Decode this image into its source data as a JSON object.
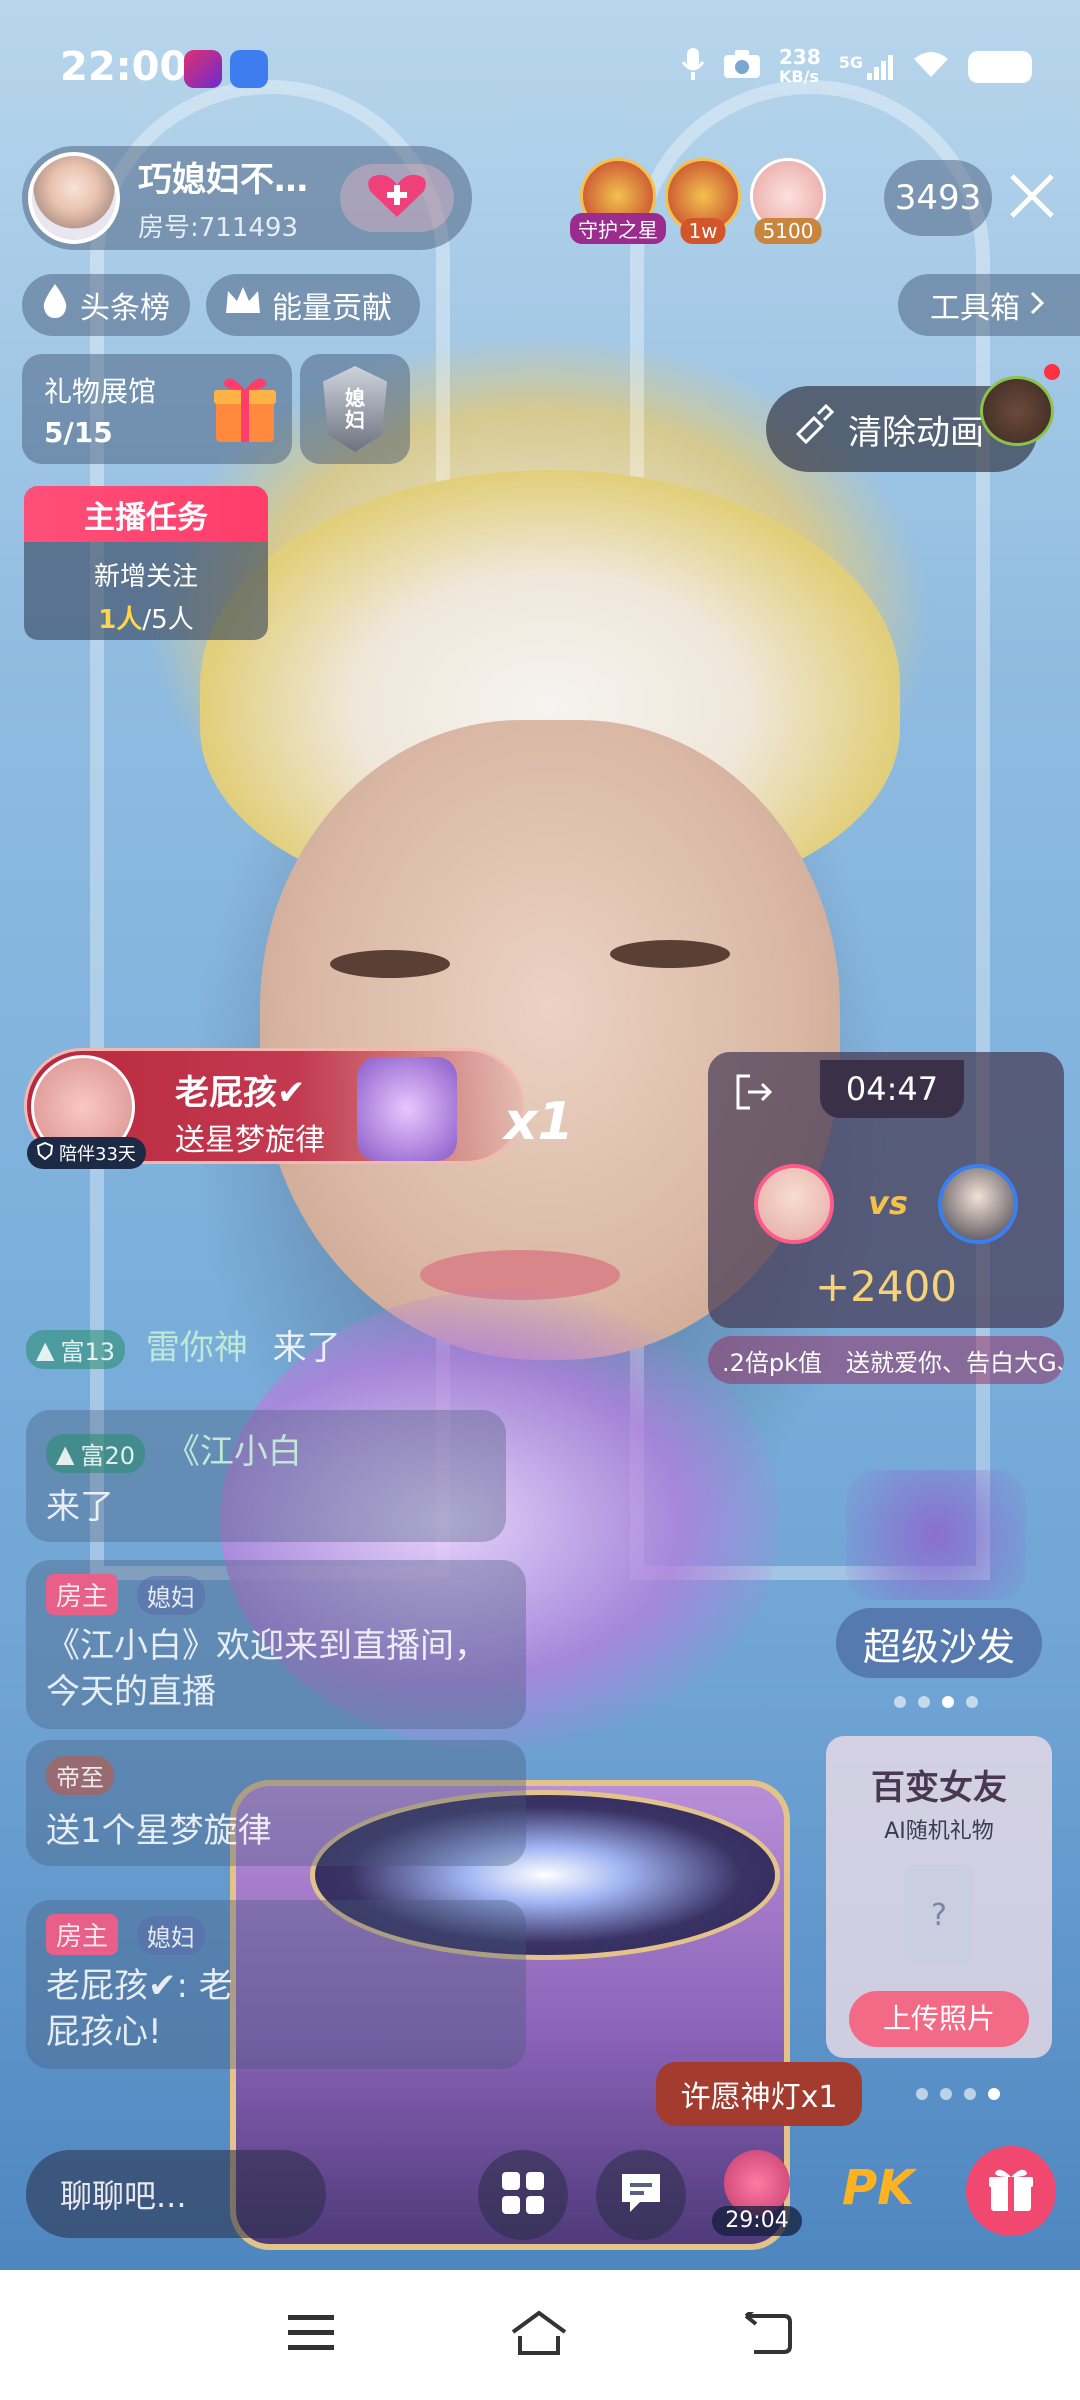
{
  "status_bar": {
    "time": "22:00",
    "network_speed_value": "238",
    "network_speed_unit": "KB/s",
    "signal_label": "5G"
  },
  "host": {
    "name": "巧媳妇不…",
    "room_id": "房号:711493"
  },
  "top_viewers": [
    {
      "tag": "守护之星"
    },
    {
      "tag": "1w"
    },
    {
      "tag": "5100"
    }
  ],
  "viewer_count": "3493",
  "rank_buttons": {
    "headline": "头条榜",
    "energy": "能量贡献",
    "toolbox": "工具箱"
  },
  "gift_hall": {
    "label": "礼物展馆",
    "progress": "5/15"
  },
  "family_badge": "媳妇",
  "clear_animation": "清除动画",
  "anchor_task": {
    "title": "主播任务",
    "item": "新增关注",
    "current": "1人",
    "total": "/5人"
  },
  "gift_banner": {
    "sender": "老屁孩✔",
    "action": "送星梦旋律",
    "count": "x1",
    "companion": "陪伴33天"
  },
  "pk": {
    "timer": "04:47",
    "vs": "vs",
    "score": "+2400",
    "ticker": ".2倍pk值　送就爱你、告白大G、"
  },
  "chat": [
    {
      "level": "富13",
      "name": "雷你神",
      "text": "来了"
    },
    {
      "level": "富20",
      "name": "《江小白",
      "text": "来了"
    },
    {
      "role": "房主",
      "fan": "媳妇",
      "text": "《江小白》欢迎来到直播间，今天的直播"
    },
    {
      "badge": "帝至",
      "text": "送1个星梦旋律"
    },
    {
      "role": "房主",
      "fan": "媳妇",
      "text": "老屁孩✔: 老屁孩心!"
    }
  ],
  "sofa": "超级沙发",
  "bianshen_card": {
    "title": "百变女友",
    "subtitle": "AI随机礼物",
    "button": "上传照片"
  },
  "wish_tip": "许愿神灯x1",
  "bottom": {
    "chat_placeholder": "聊聊吧...",
    "timer": "29:04",
    "pk_label": "PK"
  },
  "colors": {
    "task_header": "#ff4f79",
    "score": "#f6d27a",
    "gift_banner": "#b8283e"
  }
}
